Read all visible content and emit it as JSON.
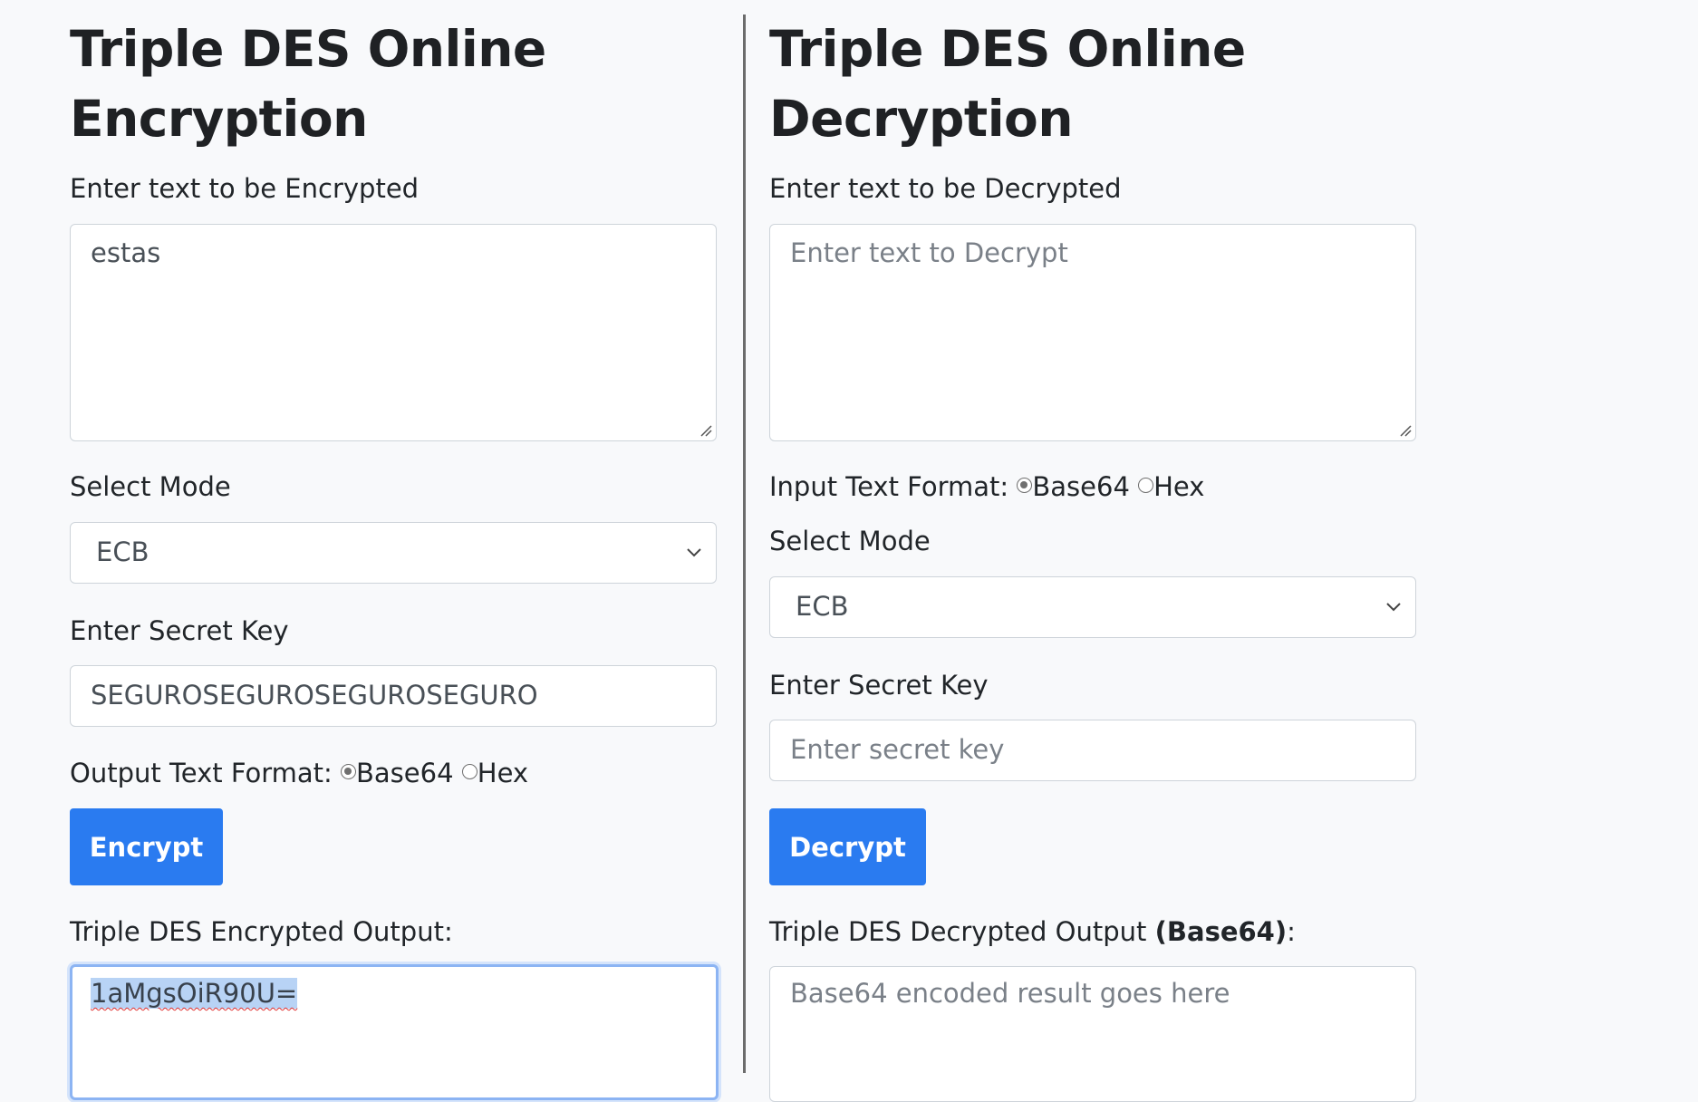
{
  "encrypt": {
    "title": "Triple DES Online Encryption",
    "title_line1": "Triple DES Online",
    "title_line2": "Encryption",
    "text_label": "Enter text to be Encrypted",
    "text_value": "estas",
    "mode_label": "Select Mode",
    "mode_value": "ECB",
    "key_label": "Enter Secret Key",
    "key_value": "SEGUROSEGUROSEGUROSEGURO",
    "format_label": "Output Text Format:",
    "format_options": [
      "Base64",
      "Hex"
    ],
    "format_selected": "Base64",
    "button_label": "Encrypt",
    "output_label": "Triple DES Encrypted Output:",
    "output_value": "1aMgsOiR90U="
  },
  "decrypt": {
    "title_line1": "Triple DES Online",
    "title_line2": "Decryption",
    "text_label": "Enter text to be Decrypted",
    "text_placeholder": "Enter text to Decrypt",
    "format_label": "Input Text Format:",
    "format_options": [
      "Base64",
      "Hex"
    ],
    "format_selected": "Base64",
    "mode_label": "Select Mode",
    "mode_value": "ECB",
    "key_label": "Enter Secret Key",
    "key_placeholder": "Enter secret key",
    "button_label": "Decrypt",
    "output_label_prefix": "Triple DES Decrypted Output ",
    "output_label_bold": "(Base64)",
    "output_label_suffix": ":",
    "output_placeholder": "Base64 encoded result goes here"
  },
  "colors": {
    "background": "#f8f9fb",
    "button": "#2a7bf0",
    "divider": "#6c6c6c",
    "focus_ring": "#8cb4f3"
  }
}
